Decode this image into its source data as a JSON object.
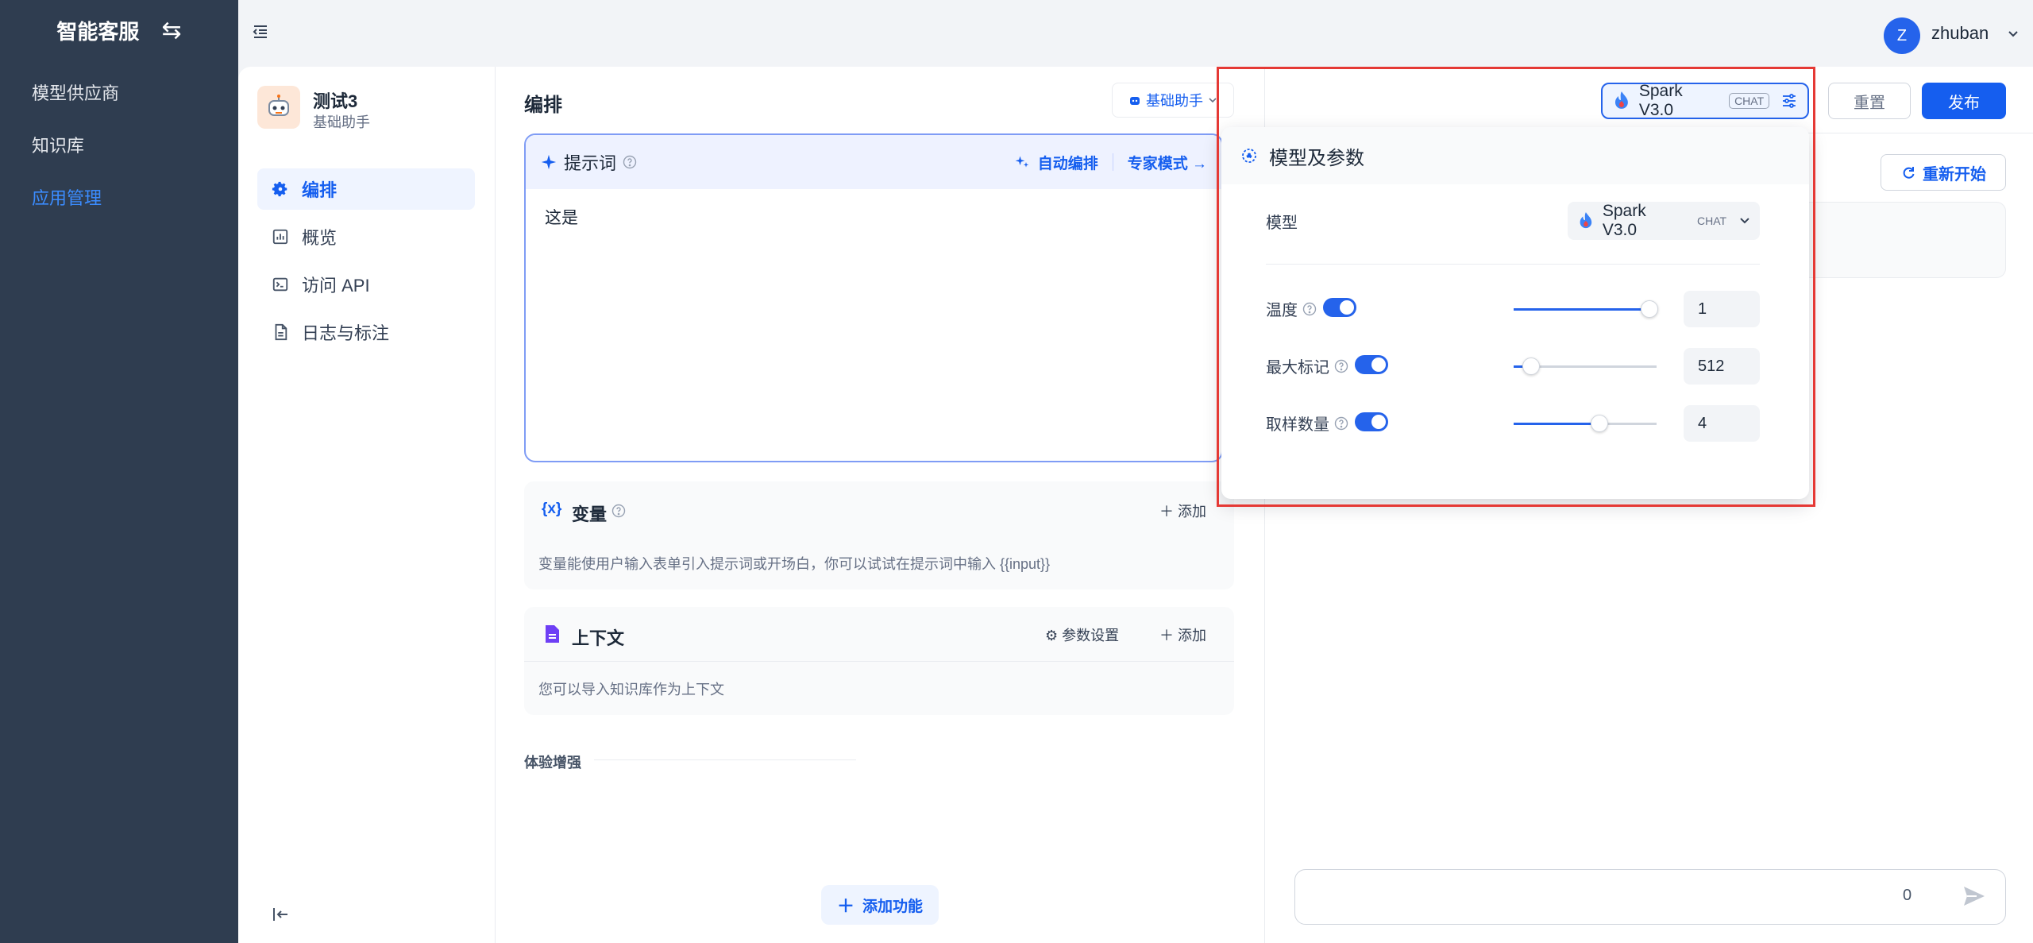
{
  "sidebar": {
    "brand": "智能客服",
    "items": [
      {
        "label": "模型供应商",
        "active": false
      },
      {
        "label": "知识库",
        "active": false
      },
      {
        "label": "应用管理",
        "active": true
      }
    ]
  },
  "user": {
    "initial": "Z",
    "name": "zhuban"
  },
  "app": {
    "name": "测试3",
    "type": "基础助手",
    "menu": [
      {
        "label": "编排",
        "icon": "gear-icon",
        "active": true
      },
      {
        "label": "概览",
        "icon": "chart-icon",
        "active": false
      },
      {
        "label": "访问 API",
        "icon": "terminal-icon",
        "active": false
      },
      {
        "label": "日志与标注",
        "icon": "document-icon",
        "active": false
      }
    ]
  },
  "editor": {
    "title": "编排",
    "assistant_mode": "基础助手",
    "prompt": {
      "title": "提示词",
      "auto_arrange": "自动编排",
      "expert_mode": "专家模式 →",
      "content": "这是"
    },
    "variables": {
      "title": "变量",
      "add": "添加",
      "desc": "变量能使用户输入表单引入提示词或开场白，你可以试试在提示词中输入 {{input}}"
    },
    "context": {
      "title": "上下文",
      "param_settings": "参数设置",
      "add": "添加",
      "desc": "您可以导入知识库作为上下文"
    },
    "experience_label": "体验增强",
    "add_feature": "添加功能"
  },
  "debug": {
    "model_name": "Spark V3.0",
    "model_tag": "CHAT",
    "reset": "重置",
    "publish": "发布",
    "restart": "重新开始",
    "char_count": "0"
  },
  "model_params": {
    "title": "模型及参数",
    "model_label": "模型",
    "model_value": "Spark V3.0",
    "model_tag": "CHAT",
    "params": [
      {
        "label": "温度",
        "enabled": true,
        "value": "1",
        "fraction": 0.95
      },
      {
        "label": "最大标记",
        "enabled": true,
        "value": "512",
        "fraction": 0.12
      },
      {
        "label": "取样数量",
        "enabled": true,
        "value": "4",
        "fraction": 0.6
      }
    ]
  },
  "colors": {
    "primary": "#155eef",
    "sidebar_bg": "#2f3d50",
    "highlight": "#e53935"
  }
}
